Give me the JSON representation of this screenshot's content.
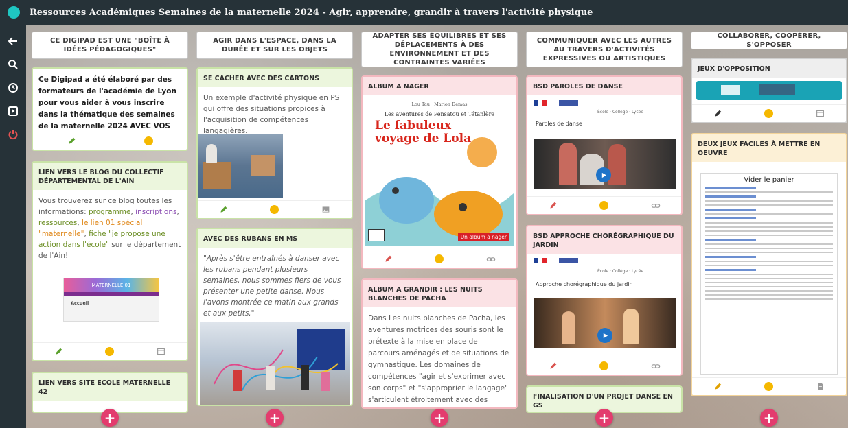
{
  "app": {
    "title": "Ressources Académiques Semaines de la maternelle 2024 - Agir, apprendre, grandir à travers l'activité physique"
  },
  "sidebar": {
    "items": [
      {
        "name": "back-arrow-icon",
        "glyph": "←"
      },
      {
        "name": "search-icon",
        "glyph": "search"
      },
      {
        "name": "clock-icon",
        "glyph": "clock"
      },
      {
        "name": "present-icon",
        "glyph": "present"
      },
      {
        "name": "power-icon",
        "glyph": "power"
      }
    ]
  },
  "columns": [
    {
      "header": "CE DIGIPAD EST UNE \"BOÎTE À IDÉES PÉDAGOGIQUES\""
    },
    {
      "header": "AGIR DANS L'ESPACE, DANS LA DURÉE ET SUR LES OBJETS"
    },
    {
      "header": "ADAPTER SES ÉQUILIBRES ET SES DÉPLACEMENTS À DES ENVIRONNEMENT ET DES CONTRAINTES VARIÉES"
    },
    {
      "header": "COMMUNIQUER AVEC LES AUTRES AU TRAVERS D'ACTIVITÉS EXPRESSIVES OU ARTISTIQUES"
    },
    {
      "header": "COLLABORER, COOPÉRER, S'OPPOSER"
    }
  ],
  "cards": {
    "c1_intro": {
      "body": "Ce Digipad a été élaboré par des formateurs de l'académie de Lyon pour vous aider à vous inscrire dans la thématique des semaines de la maternelle 2024 AVEC VOS ELEVES."
    },
    "c1_blog": {
      "title": "LIEN VERS LE BLOG DU COLLECTIF DÉPARTEMENTAL DE L'AIN",
      "text_before": "Vous trouverez sur ce blog toutes les informations: ",
      "link_programme": "programme",
      "sep1": ", ",
      "link_inscriptions": "inscriptions",
      "sep2": ", ",
      "link_ressources": "ressources",
      "sep3": ", ",
      "link_special": "le lien 01 spécial \"maternelle\"",
      "sep4": ", ",
      "link_fiche": "fiche \"je propose une action dans l'école\"",
      "text_after": " sur le département de l'Ain!",
      "thumb_banner": "MATERNELLE 01",
      "thumb_tab": "Accueil"
    },
    "c1_ecole": {
      "title": "LIEN VERS SITE ECOLE MATERNELLE 42"
    },
    "c2_cartons": {
      "title": "SE CACHER AVEC DES CARTONS",
      "body": "Un exemple d'activité physique en PS qui offre des situations propices à l'acquisition de compétences langagières."
    },
    "c2_rubans": {
      "title": "AVEC DES RUBANS EN MS",
      "body": "\"Après s'être entraînés à danser avec les rubans pendant plusieurs semaines, nous sommes fiers de vous présenter une petite danse. Nous l'avons montrée ce matin aux grands et aux petits.\""
    },
    "c3_nager": {
      "title": "ALBUM A NAGER",
      "book_authors": "Lou Tau · Marion Demas",
      "book_series": "Les aventures de Pensatou et Tétanlère",
      "book_title": "Le fabuleux voyage de Lola",
      "book_chip": "Un album à nager"
    },
    "c3_grandir": {
      "title": "ALBUM A GRANDIR : LES NUITS BLANCHES DE PACHA",
      "body": "Dans Les nuits blanches de Pacha, les aventures motrices des souris sont le prétexte à la mise en place de parcours aménagés et de situations de gymnastique. Les domaines de compétences \"agir et s'exprimer avec son corps\" et \"s'approprier le langage\" s'articulent étroitement avec des situations de repérage dans l'espace et"
    },
    "c4_paroles": {
      "title": "BSD PAROLES DE DANSE",
      "tags": [
        "École",
        "Collège",
        "Lycée"
      ],
      "video_title": "Paroles de danse"
    },
    "c4_jardin": {
      "title": "BSD APPROCHE CHORÉGRAPHIQUE DU JARDIN",
      "tags": [
        "École",
        "Collège",
        "Lycée"
      ],
      "video_title": "Approche chorégraphique du jardin"
    },
    "c4_final": {
      "title": "FINALISATION D'UN PROJET DANSE EN GS"
    },
    "c5_opposition": {
      "title": "JEUX D'OPPOSITION"
    },
    "c5_jeux": {
      "title": "DEUX JEUX FACILES À METTRE EN OEUVRE",
      "doc_title": "Vider le panier"
    }
  },
  "colors": {
    "topbar": "#263238",
    "accent_add": "#e33c6e",
    "indicator": "#f5b800",
    "edit_green": "#5aa02c",
    "edit_red": "#d9534f",
    "edit_yellow": "#e0a100"
  }
}
